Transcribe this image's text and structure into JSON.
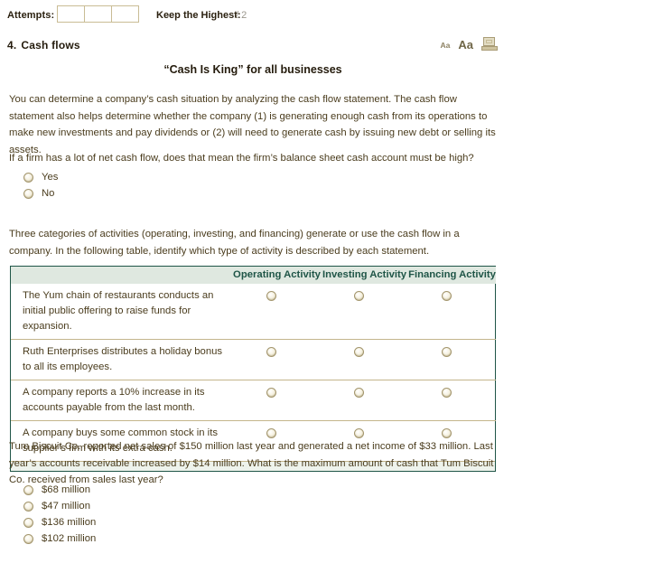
{
  "topbar": {
    "attempts_label": "Attempts:",
    "attempt_boxes": [
      "",
      "",
      ""
    ],
    "keep_highest_label": "Keep the Highest:",
    "keep_highest_value": "/ 2"
  },
  "section": {
    "number": "4.",
    "heading": "Cash flows",
    "icons": {
      "font_small": "Aa",
      "font_large": "Aa",
      "monitor": "monitor-icon"
    }
  },
  "body": {
    "title": "“Cash Is King” for all businesses",
    "intro": "You can determine a company’s cash situation by analyzing the cash flow statement. The cash flow statement also helps determine whether the company (1) is generating enough cash from its operations to make new investments and pay dividends or (2) will need to generate cash by issuing new debt or selling its assets.",
    "question_1": "If a firm has a lot of net cash flow, does that mean the firm’s balance sheet cash account must be high?",
    "question_1_options": [
      {
        "label": "Yes"
      },
      {
        "label": "No"
      }
    ],
    "three_categories": "Three categories of activities (operating, investing, and financing) generate or use the cash flow in a company. In the following table, identify which type of activity is described by each statement.",
    "final_question": "Tum Biscuit Co. reported net sales of $150 million last year and generated a net income of $33 million. Last year’s accounts receivable increased by $14 million. What is the maximum amount of cash that Tum Biscuit Co. received from sales last year?",
    "final_options": [
      {
        "label": "$68 million"
      },
      {
        "label": "$47 million"
      },
      {
        "label": "$136 million"
      },
      {
        "label": "$102 million"
      }
    ]
  },
  "table": {
    "headers": [
      "",
      "Operating Activity",
      "Investing Activity",
      "Financing Activity"
    ],
    "rows": [
      {
        "statement": "The Yum chain of restaurants conducts an initial public offering to raise funds for expansion."
      },
      {
        "statement": "Ruth Enterprises distributes a holiday bonus to all its employees."
      },
      {
        "statement": "A company reports a 10% increase in its accounts payable from the last month."
      },
      {
        "statement": "A company buys some common stock in its supplier’s firm with its extra cash."
      }
    ]
  },
  "colors": {
    "table_border": "#1f5547",
    "header_bg": "#dfe8e0",
    "header_text": "#1f5547",
    "row_divider": "#c4b68c",
    "text": "#4a3c1d",
    "radio_border": "#a3956c",
    "attempt_border": "#c9bc95"
  }
}
